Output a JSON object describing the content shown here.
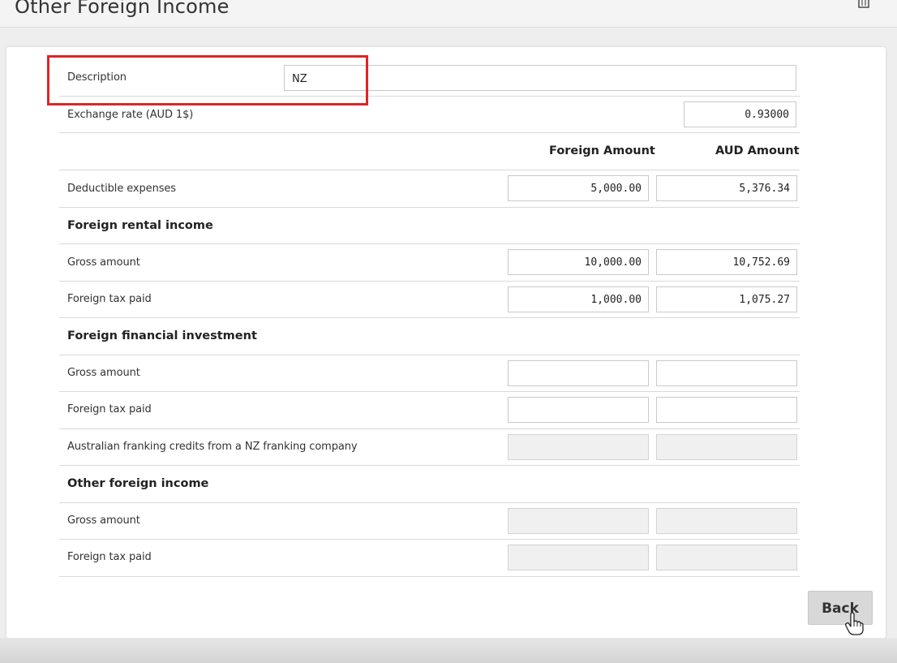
{
  "header": {
    "title": "Other Foreign Income",
    "trash_icon": "trash-icon"
  },
  "form": {
    "description": {
      "label": "Description",
      "value": "NZ"
    },
    "exchange_rate": {
      "label": "Exchange rate (AUD 1$)",
      "value": "0.93000"
    },
    "columns": {
      "foreign": "Foreign Amount",
      "aud": "AUD Amount"
    },
    "deductible": {
      "label": "Deductible expenses",
      "foreign": "5,000.00",
      "aud": "5,376.34"
    },
    "rental": {
      "title": "Foreign rental income",
      "gross": {
        "label": "Gross amount",
        "foreign": "10,000.00",
        "aud": "10,752.69"
      },
      "tax": {
        "label": "Foreign tax paid",
        "foreign": "1,000.00",
        "aud": "1,075.27"
      }
    },
    "financial": {
      "title": "Foreign financial investment",
      "gross": {
        "label": "Gross amount",
        "foreign": "",
        "aud": ""
      },
      "tax": {
        "label": "Foreign tax paid",
        "foreign": "",
        "aud": ""
      },
      "franking": {
        "label": "Australian franking credits from a NZ franking company",
        "foreign": "",
        "aud": ""
      }
    },
    "other": {
      "title": "Other foreign income",
      "gross": {
        "label": "Gross amount",
        "foreign": "",
        "aud": ""
      },
      "tax": {
        "label": "Foreign tax paid",
        "foreign": "",
        "aud": ""
      }
    }
  },
  "footer": {
    "back_label": "Back"
  },
  "colors": {
    "highlight": "#e02424",
    "button_bg": "#d8d8d8"
  }
}
